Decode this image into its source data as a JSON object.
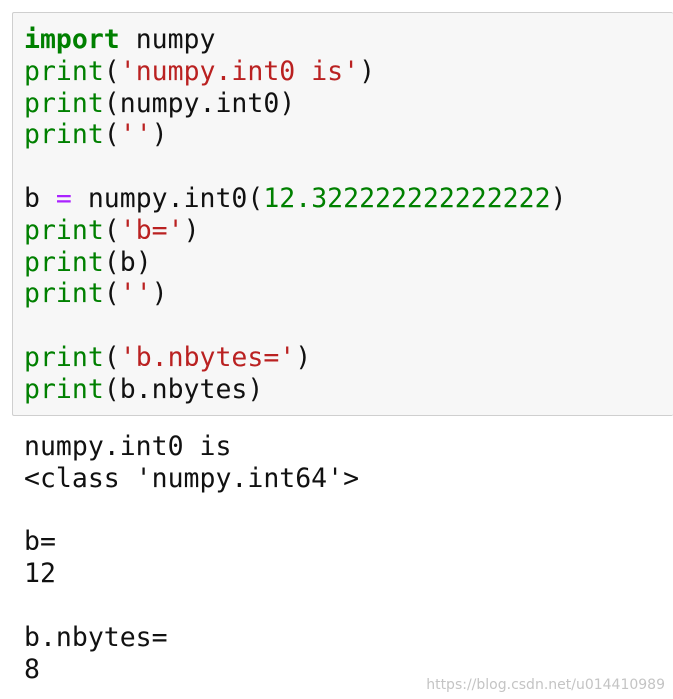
{
  "code_lines": [
    [
      {
        "t": "import",
        "c": "kw"
      },
      {
        "t": " numpy",
        "c": ""
      }
    ],
    [
      {
        "t": "print",
        "c": "fn"
      },
      {
        "t": "(",
        "c": ""
      },
      {
        "t": "'numpy.int0 is'",
        "c": "str"
      },
      {
        "t": ")",
        "c": ""
      }
    ],
    [
      {
        "t": "print",
        "c": "fn"
      },
      {
        "t": "(numpy.int0)",
        "c": ""
      }
    ],
    [
      {
        "t": "print",
        "c": "fn"
      },
      {
        "t": "(",
        "c": ""
      },
      {
        "t": "''",
        "c": "str"
      },
      {
        "t": ")",
        "c": ""
      }
    ],
    [],
    [
      {
        "t": "b ",
        "c": ""
      },
      {
        "t": "=",
        "c": "op"
      },
      {
        "t": " numpy.int0(",
        "c": ""
      },
      {
        "t": "12.322222222222222",
        "c": "num"
      },
      {
        "t": ")",
        "c": ""
      }
    ],
    [
      {
        "t": "print",
        "c": "fn"
      },
      {
        "t": "(",
        "c": ""
      },
      {
        "t": "'b='",
        "c": "str"
      },
      {
        "t": ")",
        "c": ""
      }
    ],
    [
      {
        "t": "print",
        "c": "fn"
      },
      {
        "t": "(b)",
        "c": ""
      }
    ],
    [
      {
        "t": "print",
        "c": "fn"
      },
      {
        "t": "(",
        "c": ""
      },
      {
        "t": "''",
        "c": "str"
      },
      {
        "t": ")",
        "c": ""
      }
    ],
    [],
    [
      {
        "t": "print",
        "c": "fn"
      },
      {
        "t": "(",
        "c": ""
      },
      {
        "t": "'b.nbytes='",
        "c": "str"
      },
      {
        "t": ")",
        "c": ""
      }
    ],
    [
      {
        "t": "print",
        "c": "fn"
      },
      {
        "t": "(b.nbytes)",
        "c": ""
      }
    ]
  ],
  "output": {
    "lines": [
      "numpy.int0 is",
      "<class 'numpy.int64'>",
      "",
      "b=",
      "12",
      "",
      "b.nbytes=",
      "8"
    ]
  },
  "watermark": "https://blog.csdn.net/u014410989"
}
